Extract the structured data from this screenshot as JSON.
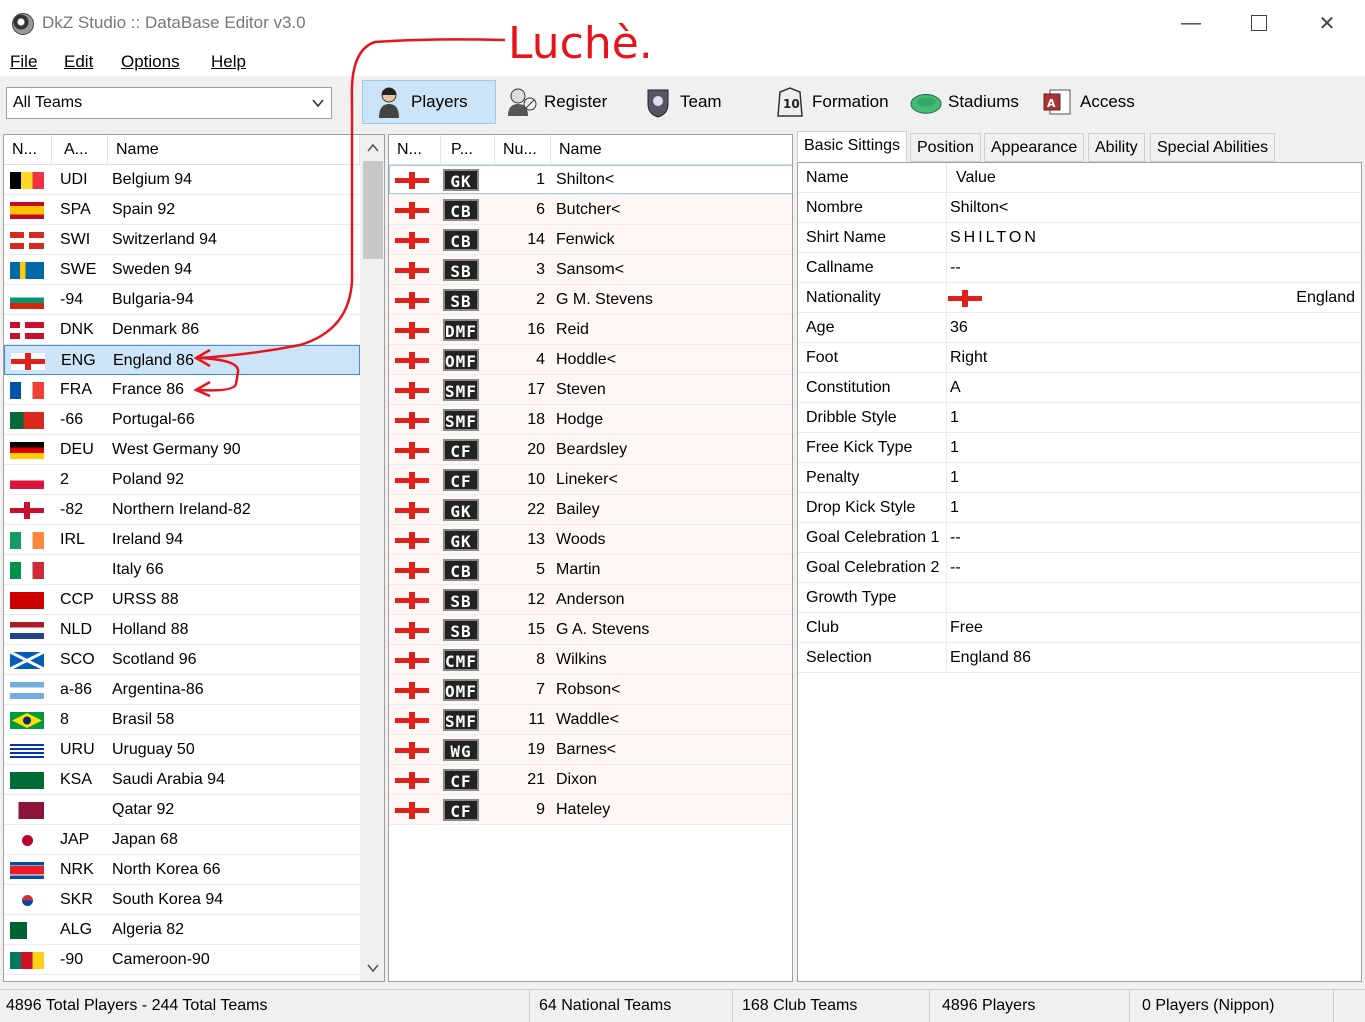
{
  "window": {
    "title": "DkZ Studio :: DataBase Editor v3.0"
  },
  "menu": [
    {
      "label": "File"
    },
    {
      "label": "Edit"
    },
    {
      "label": "Options"
    },
    {
      "label": "Help"
    }
  ],
  "toolbar": {
    "team_filter": "All Teams",
    "buttons": [
      {
        "label": "Players",
        "icon": "player-icon"
      },
      {
        "label": "Register",
        "icon": "register-icon"
      },
      {
        "label": "Team",
        "icon": "team-icon"
      },
      {
        "label": "Formation",
        "icon": "formation-icon"
      },
      {
        "label": "Stadiums",
        "icon": "stadium-icon"
      },
      {
        "label": "Access",
        "icon": "access-icon"
      }
    ]
  },
  "teams": {
    "columns": [
      "N...",
      "A...",
      "Name"
    ],
    "rows": [
      {
        "abbr": "UDI",
        "name": "Belgium 94",
        "flag": "belgium"
      },
      {
        "abbr": "SPA",
        "name": "Spain 92",
        "flag": "spain"
      },
      {
        "abbr": "SWI",
        "name": "Switzerland 94",
        "flag": "switzerland"
      },
      {
        "abbr": "SWE",
        "name": "Sweden 94",
        "flag": "sweden"
      },
      {
        "abbr": "-94",
        "name": "Bulgaria-94",
        "flag": "bulgaria"
      },
      {
        "abbr": "DNK",
        "name": "Denmark 86",
        "flag": "denmark"
      },
      {
        "abbr": "ENG",
        "name": "England 86",
        "flag": "england",
        "selected": true
      },
      {
        "abbr": "FRA",
        "name": "France 86",
        "flag": "france"
      },
      {
        "abbr": "-66",
        "name": "Portugal-66",
        "flag": "portugal"
      },
      {
        "abbr": "DEU",
        "name": "West Germany 90",
        "flag": "germany"
      },
      {
        "abbr": "2",
        "name": "Poland 92",
        "flag": "poland"
      },
      {
        "abbr": "-82",
        "name": "Northern Ireland-82",
        "flag": "nireland"
      },
      {
        "abbr": "IRL",
        "name": "Ireland 94",
        "flag": "ireland"
      },
      {
        "abbr": "",
        "name": "Italy 66",
        "flag": "italy"
      },
      {
        "abbr": "CCP",
        "name": "URSS 88",
        "flag": "ussr"
      },
      {
        "abbr": "NLD",
        "name": "Holland 88",
        "flag": "netherlands"
      },
      {
        "abbr": "SCO",
        "name": "Scotland 96",
        "flag": "scotland"
      },
      {
        "abbr": "a-86",
        "name": "Argentina-86",
        "flag": "argentina"
      },
      {
        "abbr": "8",
        "name": "Brasil 58",
        "flag": "brazil"
      },
      {
        "abbr": "URU",
        "name": "Uruguay 50",
        "flag": "uruguay"
      },
      {
        "abbr": "KSA",
        "name": "Saudi Arabia 94",
        "flag": "saudi"
      },
      {
        "abbr": "",
        "name": "Qatar 92",
        "flag": "qatar"
      },
      {
        "abbr": "JAP",
        "name": "Japan 68",
        "flag": "japan"
      },
      {
        "abbr": "NRK",
        "name": "North Korea 66",
        "flag": "nkorea"
      },
      {
        "abbr": "SKR",
        "name": "South Korea 94",
        "flag": "skorea"
      },
      {
        "abbr": "ALG",
        "name": "Algeria 82",
        "flag": "algeria"
      },
      {
        "abbr": "-90",
        "name": "Cameroon-90",
        "flag": "cameroon"
      }
    ]
  },
  "players": {
    "columns": [
      "N...",
      "P...",
      "Nu...",
      "Name"
    ],
    "rows": [
      {
        "pos": "GK",
        "num": "1",
        "name": "Shilton<"
      },
      {
        "pos": "CB",
        "num": "6",
        "name": "Butcher<"
      },
      {
        "pos": "CB",
        "num": "14",
        "name": "Fenwick"
      },
      {
        "pos": "SB",
        "num": "3",
        "name": "Sansom<"
      },
      {
        "pos": "SB",
        "num": "2",
        "name": "G M. Stevens"
      },
      {
        "pos": "DMF",
        "num": "16",
        "name": "Reid"
      },
      {
        "pos": "OMF",
        "num": "4",
        "name": "Hoddle<"
      },
      {
        "pos": "SMF",
        "num": "17",
        "name": "Steven"
      },
      {
        "pos": "SMF",
        "num": "18",
        "name": "Hodge"
      },
      {
        "pos": "CF",
        "num": "20",
        "name": "Beardsley"
      },
      {
        "pos": "CF",
        "num": "10",
        "name": "Lineker<"
      },
      {
        "pos": "GK",
        "num": "22",
        "name": "Bailey"
      },
      {
        "pos": "GK",
        "num": "13",
        "name": "Woods"
      },
      {
        "pos": "CB",
        "num": "5",
        "name": "Martin"
      },
      {
        "pos": "SB",
        "num": "12",
        "name": "Anderson"
      },
      {
        "pos": "SB",
        "num": "15",
        "name": "G A. Stevens"
      },
      {
        "pos": "CMF",
        "num": "8",
        "name": "Wilkins"
      },
      {
        "pos": "OMF",
        "num": "7",
        "name": "Robson<"
      },
      {
        "pos": "SMF",
        "num": "11",
        "name": "Waddle<"
      },
      {
        "pos": "WG",
        "num": "19",
        "name": "Barnes<"
      },
      {
        "pos": "CF",
        "num": "21",
        "name": "Dixon"
      },
      {
        "pos": "CF",
        "num": "9",
        "name": "Hateley"
      }
    ]
  },
  "details": {
    "tabs": [
      "Basic Sittings",
      "Position",
      "Appearance",
      "Ability",
      "Special Abilities"
    ],
    "columns": [
      "Name",
      "Value"
    ],
    "rows": [
      {
        "name": "Nombre",
        "value": "Shilton<"
      },
      {
        "name": "Shirt Name",
        "value": "SHILTON"
      },
      {
        "name": "Callname",
        "value": "--"
      },
      {
        "name": "Nationality",
        "value": "England",
        "flag": "england"
      },
      {
        "name": "Age",
        "value": "36"
      },
      {
        "name": "Foot",
        "value": "Right"
      },
      {
        "name": "Constitution",
        "value": "A"
      },
      {
        "name": "Dribble Style",
        "value": "1"
      },
      {
        "name": "Free Kick Type",
        "value": "1"
      },
      {
        "name": "Penalty",
        "value": "1"
      },
      {
        "name": "Drop Kick Style",
        "value": "1"
      },
      {
        "name": "Goal Celebration 1",
        "value": "--"
      },
      {
        "name": "Goal Celebration 2",
        "value": "--"
      },
      {
        "name": "Growth Type",
        "value": ""
      },
      {
        "name": "Club",
        "value": "Free"
      },
      {
        "name": "Selection",
        "value": "England 86"
      }
    ]
  },
  "status": [
    "4896 Total Players  -  244 Total Teams",
    "64 National Teams",
    "168 Club Teams",
    "4896 Players",
    "0 Players (Nippon)"
  ],
  "annotation": {
    "text": "Luchè.",
    "color": "#e8141b"
  }
}
